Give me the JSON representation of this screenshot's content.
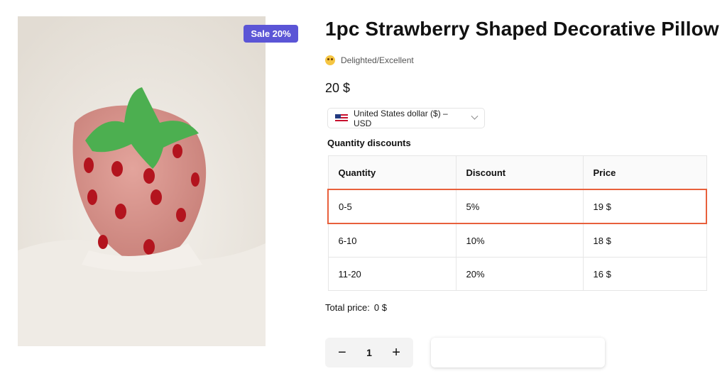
{
  "product": {
    "title": "1pc Strawberry Shaped Decorative Pillow",
    "rating_label": "Delighted/Excellent",
    "price": "20 $",
    "sale_badge": "Sale 20%"
  },
  "currency_selector": {
    "label": "United States dollar ($) – USD"
  },
  "quantity_discounts": {
    "title": "Quantity discounts",
    "headers": [
      "Quantity",
      "Discount",
      "Price"
    ],
    "rows": [
      {
        "quantity": "0-5",
        "discount": "5%",
        "price": "19 $",
        "selected": true
      },
      {
        "quantity": "6-10",
        "discount": "10%",
        "price": "18 $",
        "selected": false
      },
      {
        "quantity": "11-20",
        "discount": "20%",
        "price": "16 $",
        "selected": false
      }
    ]
  },
  "total": {
    "label": "Total price:",
    "value": "0 $"
  },
  "quantity_stepper": {
    "minus": "−",
    "value": "1",
    "plus": "+"
  },
  "colors": {
    "sale_badge": "#5b55d6",
    "selected_row_border": "#e8603c"
  }
}
